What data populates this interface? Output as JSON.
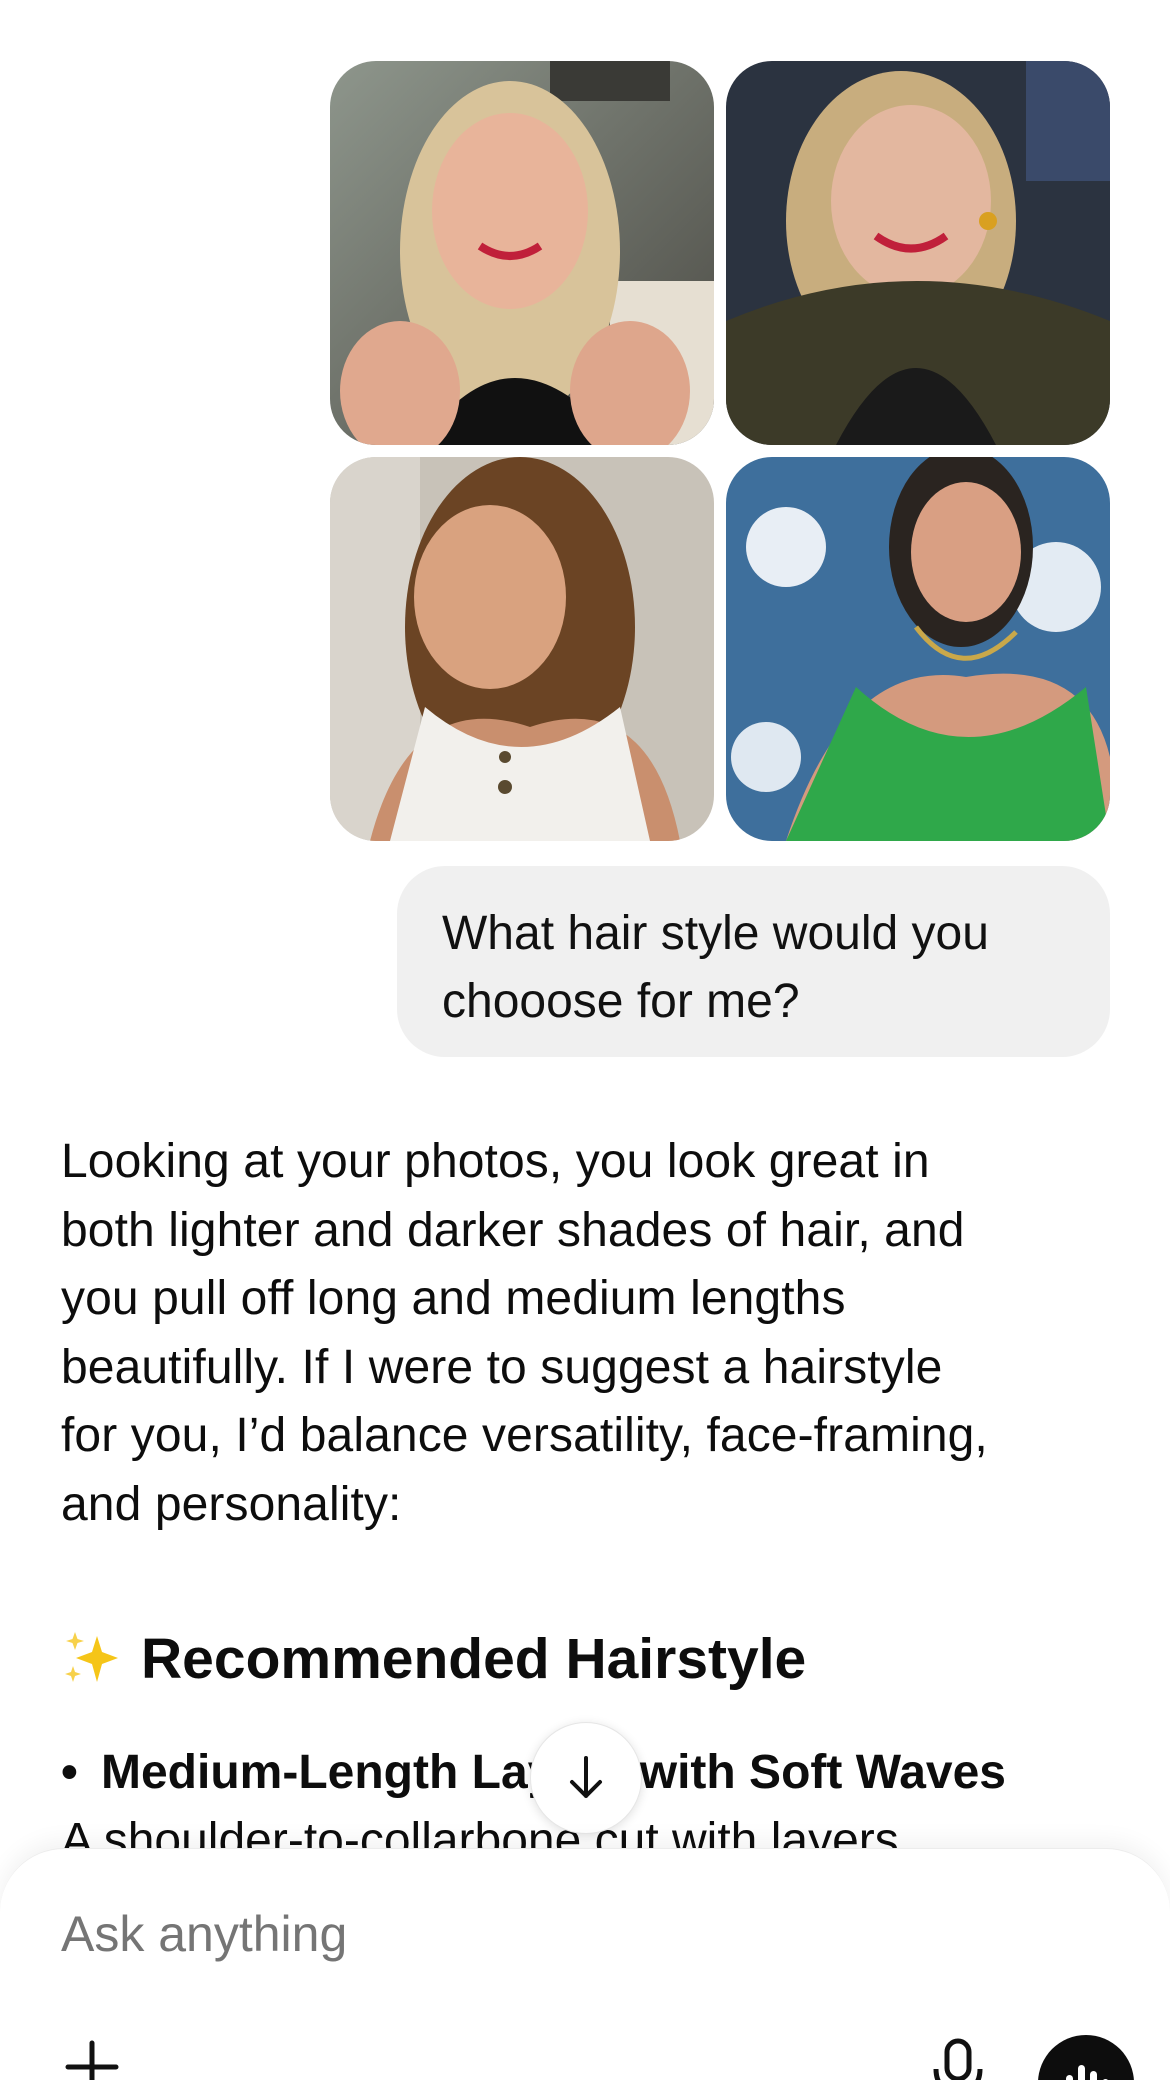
{
  "photos": [
    {
      "name": "photo-1"
    },
    {
      "name": "photo-2"
    },
    {
      "name": "photo-3"
    },
    {
      "name": "photo-4"
    }
  ],
  "user_message": {
    "line1": "What hair style would you",
    "line2": "chooose for me?"
  },
  "assistant": {
    "paragraph_lines": [
      "Looking at your photos, you look great in",
      "both lighter and darker shades of hair, and",
      "you pull off long and medium lengths",
      "beautifully. If I were to suggest a hairstyle",
      "for you, I’d balance versatility, face-framing,",
      "and personality:"
    ],
    "heading": "Recommended Hairstyle",
    "heading_icon": "sparkles-icon",
    "bullet_title": "Medium-Length Layers with Soft Waves",
    "bullet_sub": "A shoulder-to-collarbone cut with layers"
  },
  "composer": {
    "placeholder": "Ask anything"
  },
  "colors": {
    "bubble": "#f0f0f0",
    "text": "#0d0d0d",
    "placeholder": "#8e8e8e",
    "voice_button": "#0d0d0d"
  }
}
